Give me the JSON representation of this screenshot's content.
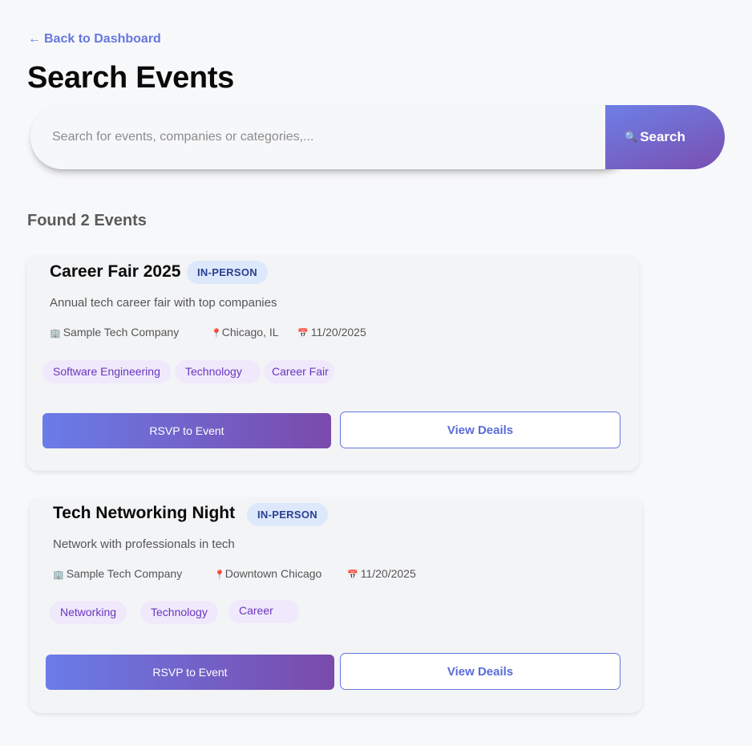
{
  "nav": {
    "back_arrow": "←",
    "back_label": "Back to Dashboard"
  },
  "page": {
    "title": "Search Events"
  },
  "search": {
    "placeholder": "Search for events, companies or categories,...",
    "value": "",
    "button_icon": "🔍",
    "button_label": "Search"
  },
  "results": {
    "count_label": "Found 2 Events"
  },
  "events": [
    {
      "title": "Career Fair 2025",
      "type": "IN-PERSON",
      "description": "Annual tech career fair with top companies",
      "company_icon": "🏢",
      "company": "Sample Tech Company",
      "location_icon": "📍",
      "location": "Chicago, IL",
      "date_icon": "📅",
      "date": "11/20/2025",
      "tags": [
        "Software Engineering",
        "Technology",
        "Career Fair"
      ],
      "rsvp_label": "RSVP to Event",
      "details_label": "View Deails"
    },
    {
      "title": "Tech Networking Night",
      "type": "IN-PERSON",
      "description": "Network with professionals in tech",
      "company_icon": "🏢",
      "company": "Sample Tech Company",
      "location_icon": "📍",
      "location": "Downtown Chicago",
      "date_icon": "📅",
      "date": "11/20/2025",
      "tags": [
        "Networking",
        "Technology",
        "Career"
      ],
      "rsvp_label": "RSVP to Event",
      "details_label": "View Deails"
    }
  ],
  "colors": {
    "background": "#f7f8fa",
    "accent": "#6677dd",
    "gradient_start": "#6a7ce8",
    "gradient_end": "#7a4aab",
    "badge_bg": "#dde8fc",
    "badge_text": "#2b3f8f",
    "tag_bg": "#efe9fb",
    "tag_text": "#6a35bf"
  }
}
